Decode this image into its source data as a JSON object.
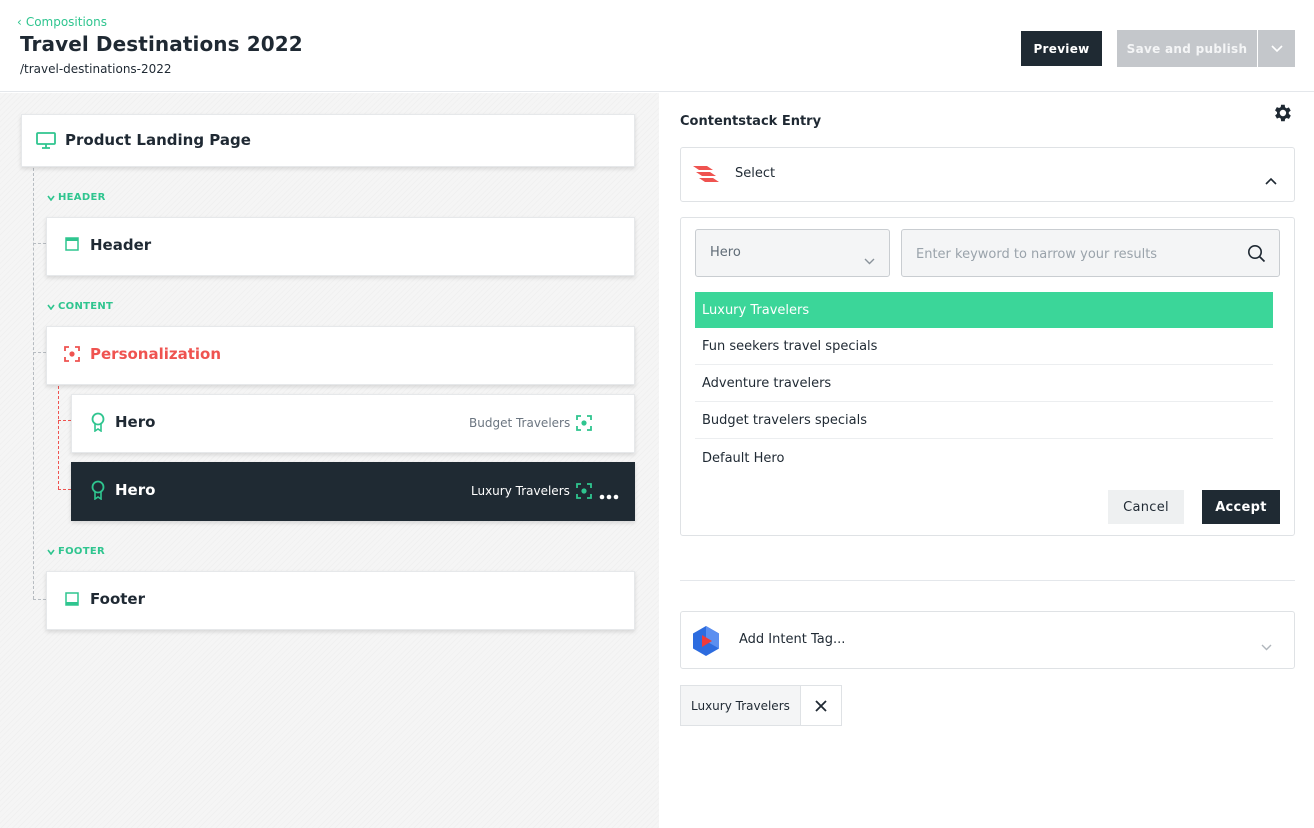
{
  "header": {
    "back_label": "Compositions",
    "title": "Travel Destinations 2022",
    "slug": "/travel-destinations-2022",
    "preview_label": "Preview",
    "publish_label": "Save and publish"
  },
  "tree": {
    "root_label": "Product Landing Page",
    "sections": {
      "header": "HEADER",
      "content": "CONTENT",
      "footer": "FOOTER"
    },
    "header_component": "Header",
    "personalization": "Personalization",
    "variants": [
      {
        "label": "Hero",
        "audience": "Budget Travelers"
      },
      {
        "label": "Hero",
        "audience": "Luxury Travelers"
      }
    ],
    "footer_component": "Footer"
  },
  "panel": {
    "section_title": "Contentstack Entry",
    "select_label": "Select",
    "type_value": "Hero",
    "search_placeholder": "Enter keyword to narrow your results",
    "results": [
      "Luxury Travelers",
      "Fun seekers travel specials",
      "Adventure travelers",
      "Budget travelers specials",
      "Default Hero"
    ],
    "selected_index": 0,
    "cancel_label": "Cancel",
    "accept_label": "Accept",
    "intent_label": "Add Intent Tag...",
    "tags": [
      "Luxury Travelers"
    ]
  },
  "colors": {
    "accent_green": "#2fc58f",
    "selection_green": "#3bd699",
    "personalization_red": "#ef5350",
    "dark": "#1f2a33"
  }
}
